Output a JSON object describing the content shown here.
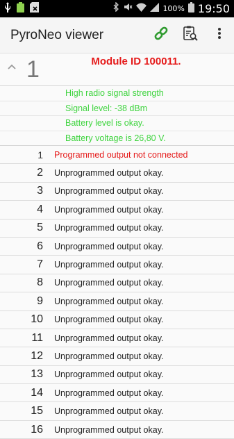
{
  "status_bar": {
    "battery_percent": "100%",
    "time": "19:50"
  },
  "app_bar": {
    "title": "PyroNeo viewer",
    "icons": [
      "link-icon",
      "clipboard-search-icon",
      "more-vert-icon"
    ],
    "accent_color": "#2e9a2e"
  },
  "module": {
    "number": "1",
    "title": "Module ID 100011.",
    "expanded": true,
    "title_color": "#e51a1a",
    "info_lines": [
      "High radio signal strength",
      "Signal level: -38 dBm",
      "Battery level is okay.",
      "Battery voltage is 26,80 V."
    ],
    "info_color": "#3fd43f"
  },
  "outputs": [
    {
      "num": "1",
      "msg": "Programmed output not connected",
      "error": true
    },
    {
      "num": "2",
      "msg": "Unprogrammed output okay.",
      "error": false
    },
    {
      "num": "3",
      "msg": "Unprogrammed output okay.",
      "error": false
    },
    {
      "num": "4",
      "msg": "Unprogrammed output okay.",
      "error": false
    },
    {
      "num": "5",
      "msg": "Unprogrammed output okay.",
      "error": false
    },
    {
      "num": "6",
      "msg": "Unprogrammed output okay.",
      "error": false
    },
    {
      "num": "7",
      "msg": "Unprogrammed output okay.",
      "error": false
    },
    {
      "num": "8",
      "msg": "Unprogrammed output okay.",
      "error": false
    },
    {
      "num": "9",
      "msg": "Unprogrammed output okay.",
      "error": false
    },
    {
      "num": "10",
      "msg": "Unprogrammed output okay.",
      "error": false
    },
    {
      "num": "11",
      "msg": "Unprogrammed output okay.",
      "error": false
    },
    {
      "num": "12",
      "msg": "Unprogrammed output okay.",
      "error": false
    },
    {
      "num": "13",
      "msg": "Unprogrammed output okay.",
      "error": false
    },
    {
      "num": "14",
      "msg": "Unprogrammed output okay.",
      "error": false
    },
    {
      "num": "15",
      "msg": "Unprogrammed output okay.",
      "error": false
    },
    {
      "num": "16",
      "msg": "Unprogrammed output okay.",
      "error": false
    }
  ]
}
